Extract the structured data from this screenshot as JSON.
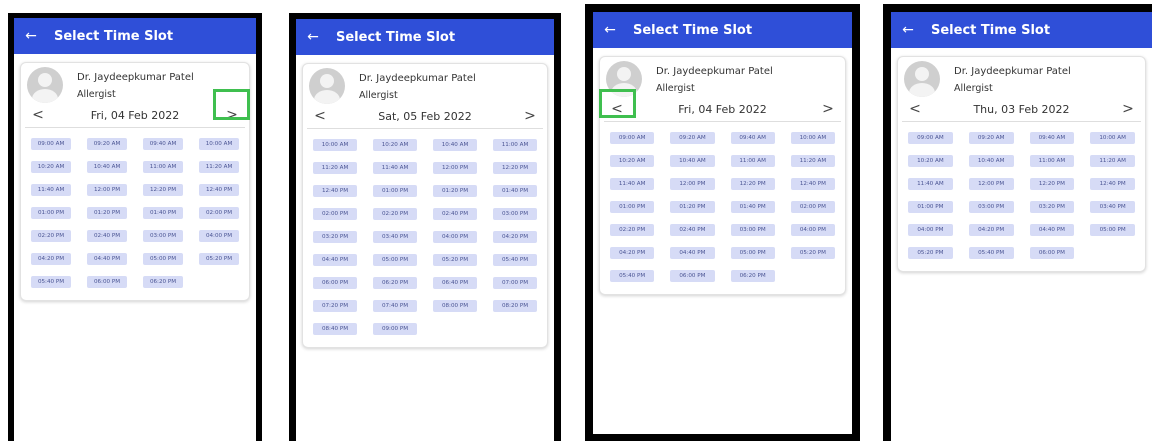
{
  "accent_color": "#2f4fd8",
  "slot_color": "#d6dbf6",
  "highlight_color": "#3fbf4f",
  "screens": [
    {
      "title": "Select Time Slot",
      "back_icon": "arrow-left-icon",
      "doctor_name": "Dr. Jaydeepkumar Patel",
      "specialty": "Allergist",
      "prev_label": "<",
      "next_label": ">",
      "date": "Fri, 04 Feb 2022",
      "slots": [
        "09:00 AM",
        "09:20 AM",
        "09:40 AM",
        "10:00 AM",
        "10:20 AM",
        "10:40 AM",
        "11:00 AM",
        "11:20 AM",
        "11:40 AM",
        "12:00 PM",
        "12:20 PM",
        "12:40 PM",
        "01:00 PM",
        "01:20 PM",
        "01:40 PM",
        "02:00 PM",
        "02:20 PM",
        "02:40 PM",
        "03:00 PM",
        "04:00 PM",
        "04:20 PM",
        "04:40 PM",
        "05:00 PM",
        "05:20 PM",
        "05:40 PM",
        "06:00 PM",
        "06:20 PM"
      ],
      "highlight": "next"
    },
    {
      "title": "Select Time Slot",
      "back_icon": "arrow-left-icon",
      "doctor_name": "Dr. Jaydeepkumar Patel",
      "specialty": "Allergist",
      "prev_label": "<",
      "next_label": ">",
      "date": "Sat, 05 Feb 2022",
      "slots": [
        "10:00 AM",
        "10:20 AM",
        "10:40 AM",
        "11:00 AM",
        "11:20 AM",
        "11:40 AM",
        "12:00 PM",
        "12:20 PM",
        "12:40 PM",
        "01:00 PM",
        "01:20 PM",
        "01:40 PM",
        "02:00 PM",
        "02:20 PM",
        "02:40 PM",
        "03:00 PM",
        "03:20 PM",
        "03:40 PM",
        "04:00 PM",
        "04:20 PM",
        "04:40 PM",
        "05:00 PM",
        "05:20 PM",
        "05:40 PM",
        "06:00 PM",
        "06:20 PM",
        "06:40 PM",
        "07:00 PM",
        "07:20 PM",
        "07:40 PM",
        "08:00 PM",
        "08:20 PM",
        "08:40 PM",
        "09:00 PM"
      ],
      "highlight": "none"
    },
    {
      "title": "Select Time Slot",
      "back_icon": "arrow-left-icon",
      "doctor_name": "Dr. Jaydeepkumar Patel",
      "specialty": "Allergist",
      "prev_label": "<",
      "next_label": ">",
      "date": "Fri, 04 Feb 2022",
      "slots": [
        "09:00 AM",
        "09:20 AM",
        "09:40 AM",
        "10:00 AM",
        "10:20 AM",
        "10:40 AM",
        "11:00 AM",
        "11:20 AM",
        "11:40 AM",
        "12:00 PM",
        "12:20 PM",
        "12:40 PM",
        "01:00 PM",
        "01:20 PM",
        "01:40 PM",
        "02:00 PM",
        "02:20 PM",
        "02:40 PM",
        "03:00 PM",
        "04:00 PM",
        "04:20 PM",
        "04:40 PM",
        "05:00 PM",
        "05:20 PM",
        "05:40 PM",
        "06:00 PM",
        "06:20 PM"
      ],
      "highlight": "prev"
    },
    {
      "title": "Select Time Slot",
      "back_icon": "arrow-left-icon",
      "doctor_name": "Dr. Jaydeepkumar Patel",
      "specialty": "Allergist",
      "prev_label": "<",
      "next_label": ">",
      "date": "Thu, 03 Feb 2022",
      "slots": [
        "09:00 AM",
        "09:20 AM",
        "09:40 AM",
        "10:00 AM",
        "10:20 AM",
        "10:40 AM",
        "11:00 AM",
        "11:20 AM",
        "11:40 AM",
        "12:00 PM",
        "12:20 PM",
        "12:40 PM",
        "01:00 PM",
        "03:00 PM",
        "03:20 PM",
        "03:40 PM",
        "04:00 PM",
        "04:20 PM",
        "04:40 PM",
        "05:00 PM",
        "05:20 PM",
        "05:40 PM",
        "06:00 PM"
      ],
      "highlight": "none"
    }
  ]
}
